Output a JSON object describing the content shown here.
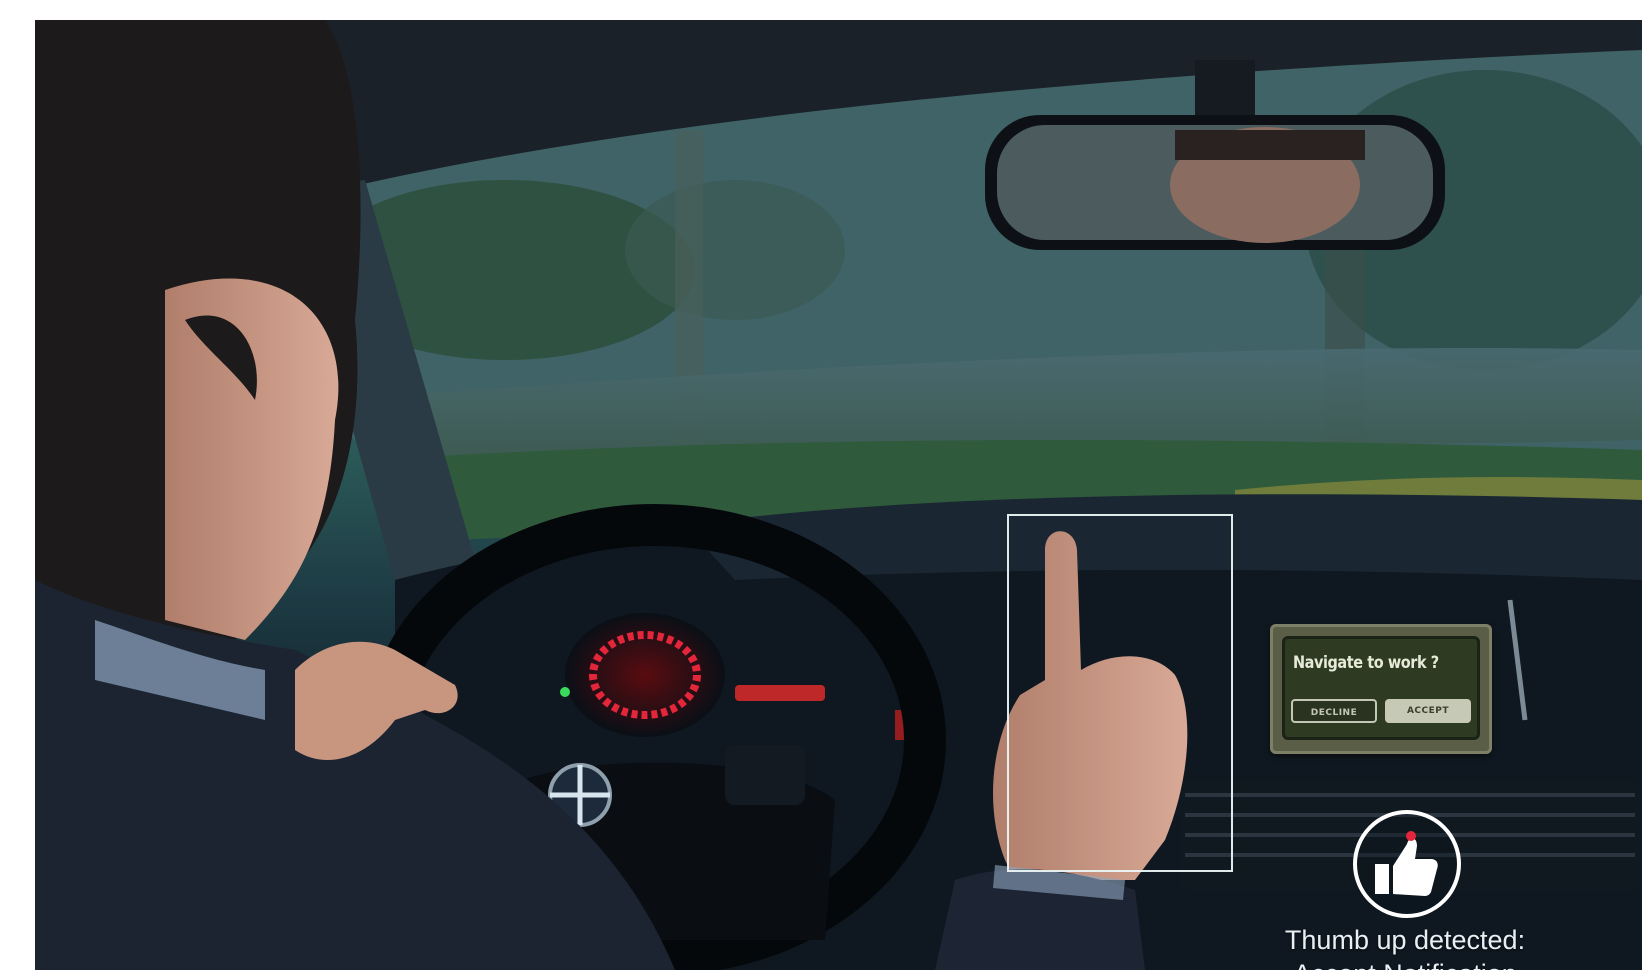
{
  "navigation_prompt": {
    "title": "Navigate to work ?",
    "decline_label": "DECLINE",
    "accept_label": "ACCEPT"
  },
  "detection": {
    "icon": "thumbs-up-icon",
    "caption_line1": "Thumb up detected:",
    "caption_line2": "Accept Notification"
  },
  "colors": {
    "detection_box": "#ebf5f5",
    "caption": "#e8f0f4",
    "screen_bg": "#2f3a23",
    "accent_red": "#e3263a"
  }
}
